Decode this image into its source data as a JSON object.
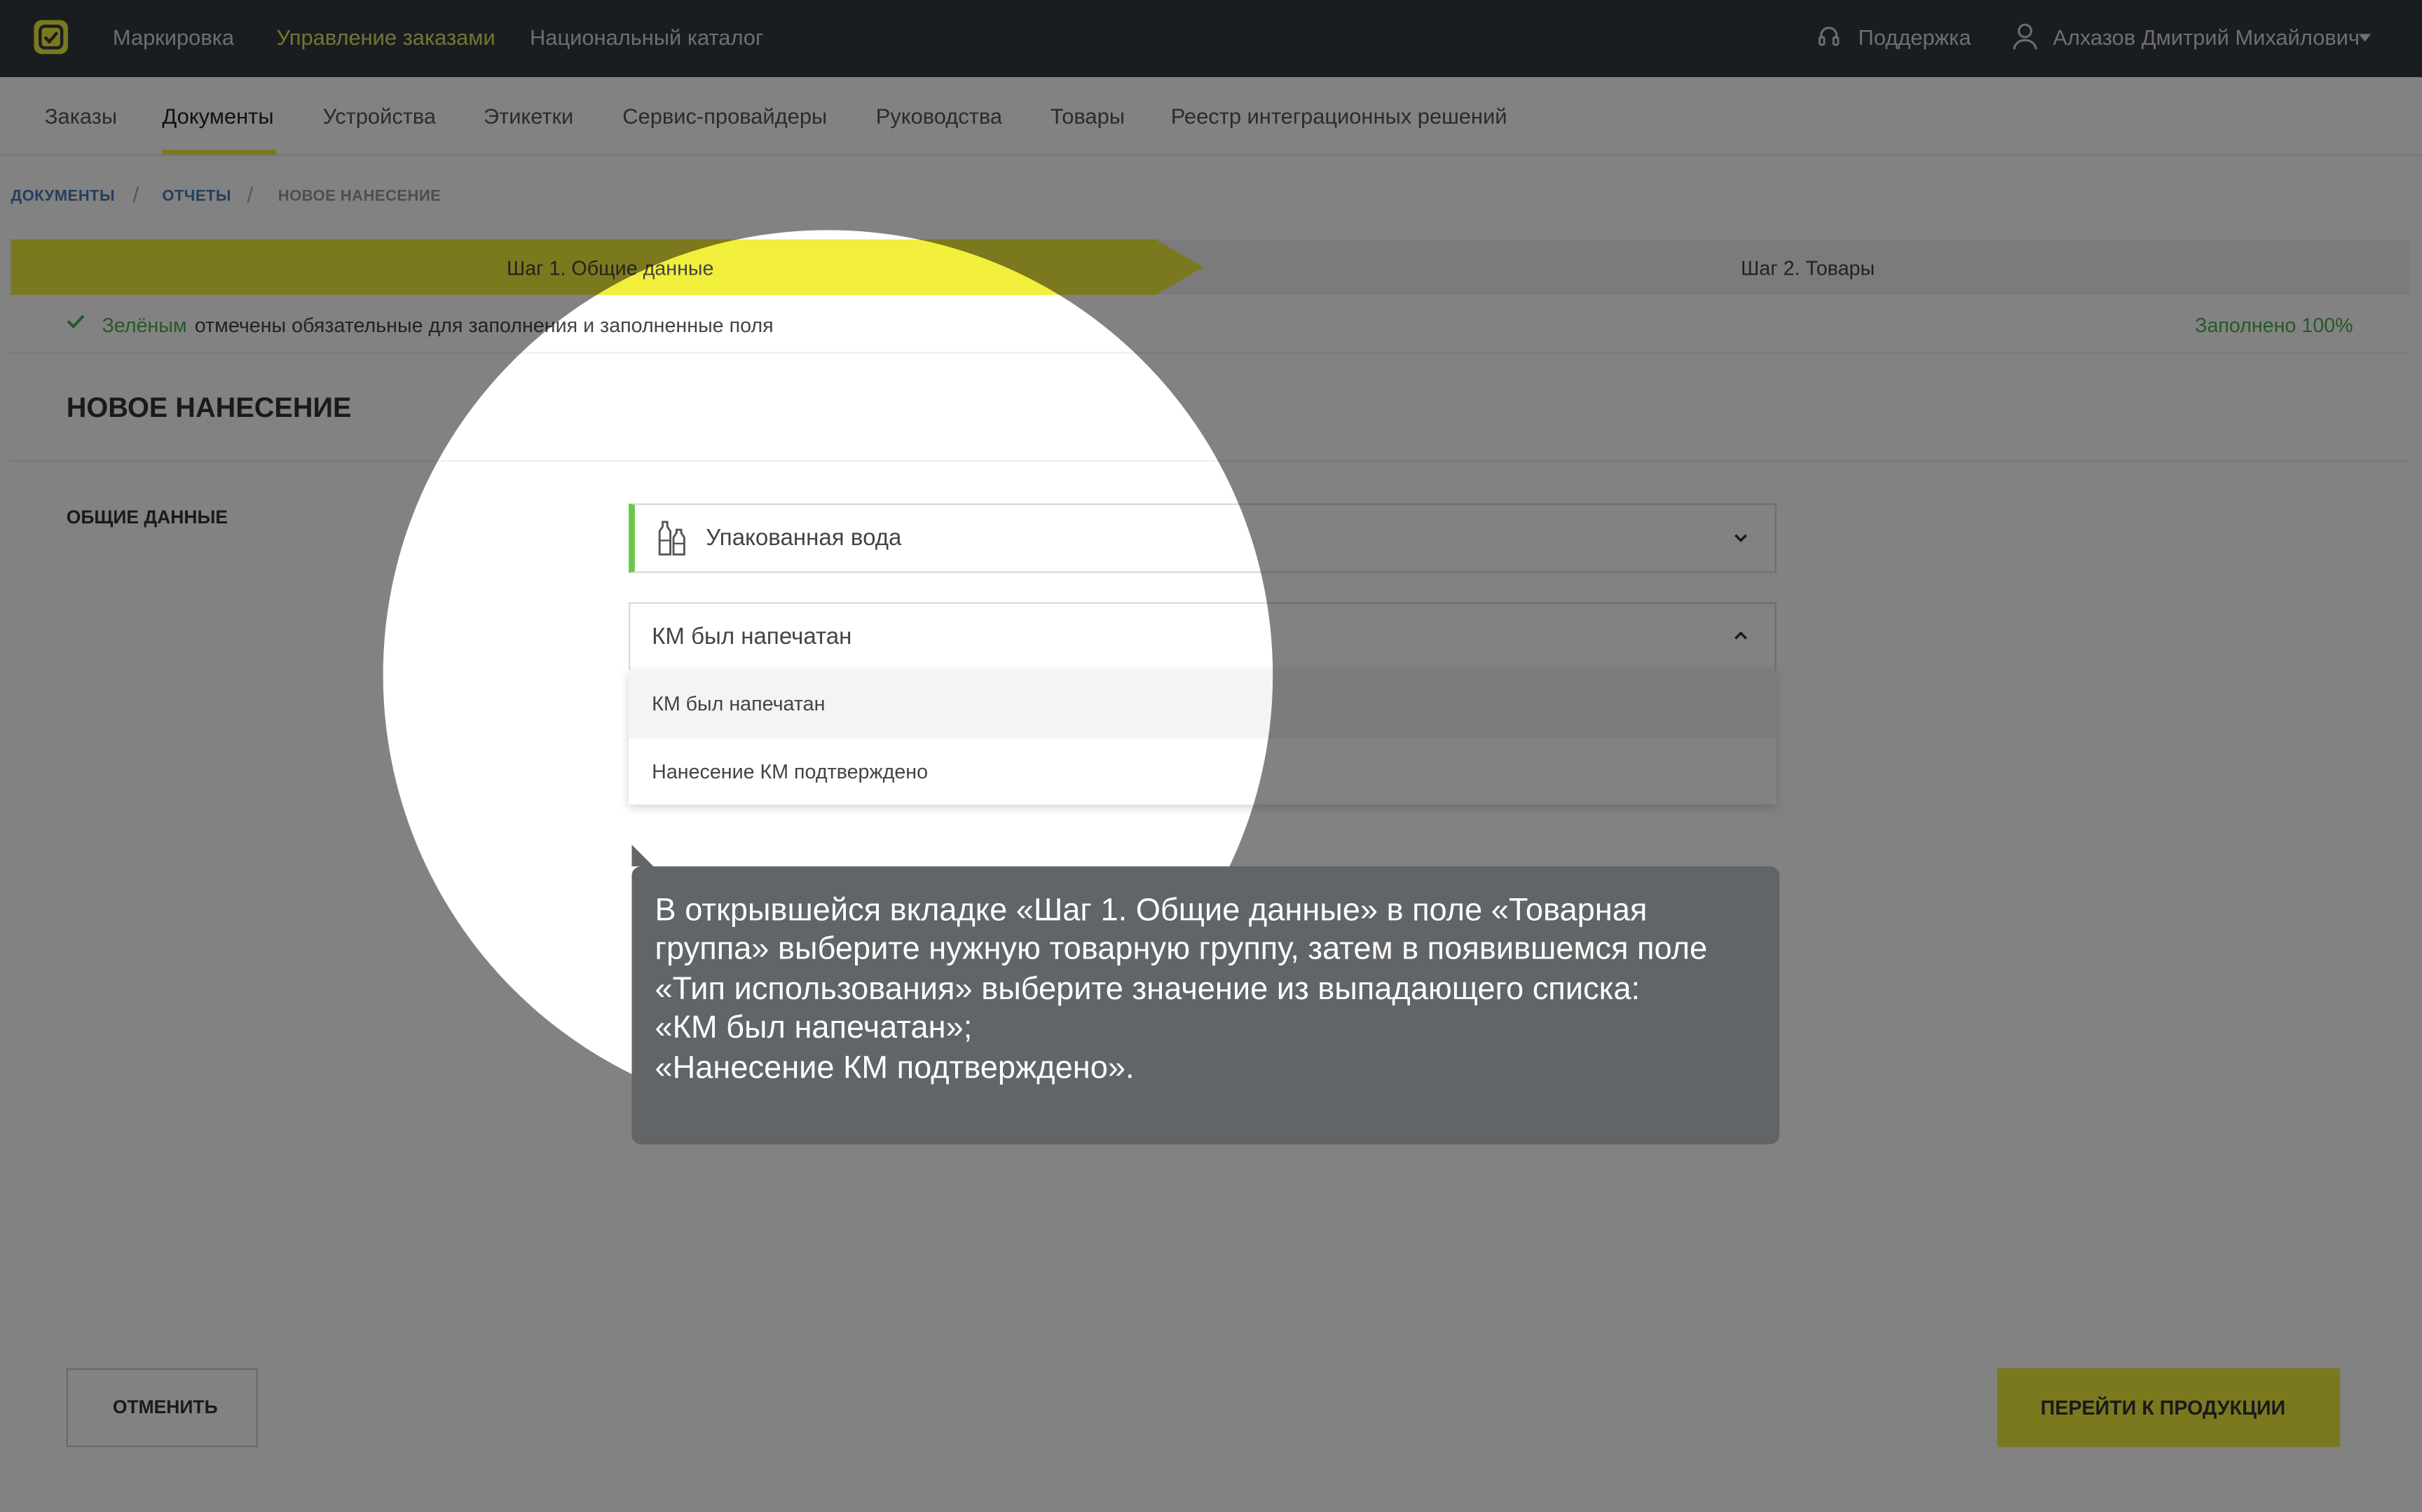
{
  "topbar": {
    "nav": [
      "Маркировка",
      "Управление заказами",
      "Национальный каталог"
    ],
    "active_index": 1,
    "support": "Поддержка",
    "user_name": "Алхазов Дмитрий Михайлович"
  },
  "subnav": {
    "items": [
      "Заказы",
      "Документы",
      "Устройства",
      "Этикетки",
      "Сервис-провайдеры",
      "Руководства",
      "Товары",
      "Реестр интеграционных решений"
    ],
    "active_index": 1
  },
  "breadcrumb": [
    "ДОКУМЕНТЫ",
    "ОТЧЕТЫ",
    "НОВОЕ НАНЕСЕНИЕ"
  ],
  "steps": [
    "Шаг 1. Общие данные",
    "Шаг 2. Товары"
  ],
  "info": {
    "green_word": "Зелёным",
    "text": "отмечены обязательные для заполнения и заполненные поля",
    "filled": "Заполнено 100%"
  },
  "page_title": "НОВОЕ НАНЕСЕНИЕ",
  "section_label": "ОБЩИЕ ДАННЫЕ",
  "product_group": {
    "value": "Упакованная вода",
    "icon": "bottles-icon"
  },
  "usage_type": {
    "value": "КМ был напечатан",
    "options": [
      "КМ был напечатан",
      "Нанесение КМ подтверждено"
    ]
  },
  "buttons": {
    "cancel": "ОТМЕНИТЬ",
    "next": "ПЕРЕЙТИ К ПРОДУКЦИИ"
  },
  "tooltip": "В открывшейся вкладке «Шаг 1. Общие данные» в поле «Товарная группа» выберите нужную товарную группу, затем в появившемся поле «Тип использования» выберите значение из выпадающего списка:\n«КМ был напечатан»;\n«Нанесение КМ подтверждено».",
  "colors": {
    "accent": "#f2ee3c",
    "success": "#4caf50",
    "topbar": "#343a40",
    "tooltip": "#616568"
  }
}
